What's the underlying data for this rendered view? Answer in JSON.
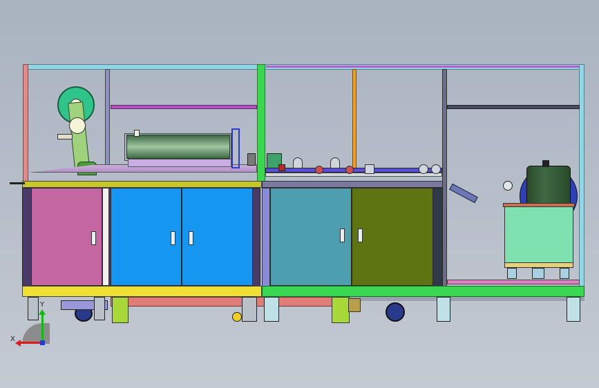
{
  "view": {
    "background_top": "#a9b3c0",
    "background_bottom": "#c4cad3"
  },
  "axes": {
    "x_label": "X",
    "y_label": "Y",
    "x_color": "#e01a1a",
    "y_color": "#14b814"
  },
  "colors": {
    "cabinet_door_1": "#c466a2",
    "cabinet_door_2": "#1596f0",
    "cabinet_door_3": "#4d9fb0",
    "cabinet_door_4": "#5e7412",
    "top_plate_left": "#c7c729",
    "top_plate_right": "#7a7aa0",
    "base_left": "#f0e034",
    "base_right": "#3ad852",
    "base_pink": "#e07d78"
  }
}
